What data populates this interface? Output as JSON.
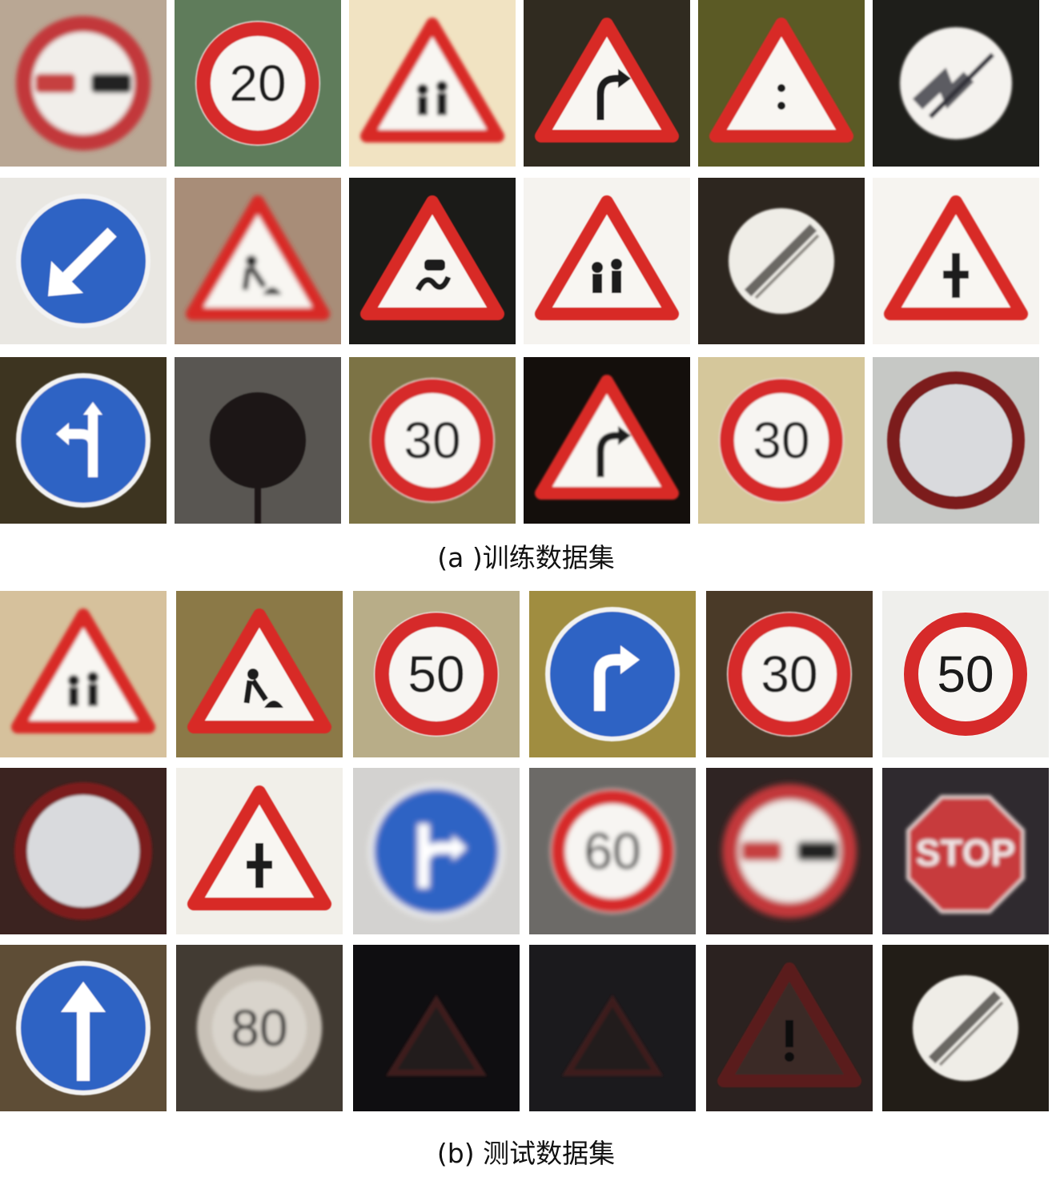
{
  "captions": {
    "train": "(a )训练数据集",
    "test": "(b) 测试数据集"
  },
  "train_tiles": [
    {
      "sign": "no-overtaking",
      "bg": "#b9a794",
      "blur": 3
    },
    {
      "sign": "speed-limit",
      "label": "20",
      "bg": "#5f7c5b",
      "blur": 0.8
    },
    {
      "sign": "warning-triangle",
      "glyph": "children",
      "bg": "#f1e3c2",
      "blur": 2
    },
    {
      "sign": "warning-triangle",
      "glyph": "curve-right",
      "bg": "#302b20",
      "blur": 0.5
    },
    {
      "sign": "warning-triangle",
      "glyph": "dot",
      "bg": "#5b5a25",
      "blur": 0.8
    },
    {
      "sign": "end-no-overtaking",
      "bg": "#1e1e1a",
      "blur": 1.5
    },
    {
      "sign": "blue-circle",
      "glyph": "arrow-down-left",
      "bg": "#e9e7e2",
      "blur": 0.6
    },
    {
      "sign": "warning-triangle",
      "glyph": "work",
      "bg": "#a88d78",
      "blur": 3
    },
    {
      "sign": "warning-triangle",
      "glyph": "slippery",
      "bg": "#1b1b18",
      "blur": 0.6
    },
    {
      "sign": "warning-triangle",
      "glyph": "children",
      "bg": "#f5f3ef",
      "blur": 0.4
    },
    {
      "sign": "end-restriction",
      "bg": "#2d261f",
      "blur": 1.2
    },
    {
      "sign": "warning-triangle",
      "glyph": "priority",
      "bg": "#f6f4f0",
      "blur": 0.8
    },
    {
      "sign": "blue-circle",
      "glyph": "straight-or-left",
      "bg": "#3d3420",
      "blur": 0.8
    },
    {
      "sign": "dark-circle",
      "bg": "#595652",
      "blur": 0.8
    },
    {
      "sign": "speed-limit",
      "label": "30",
      "bg": "#7c7345",
      "blur": 1
    },
    {
      "sign": "warning-triangle",
      "glyph": "curve-right",
      "bg": "#140f0c",
      "blur": 1.2
    },
    {
      "sign": "speed-limit",
      "label": "30",
      "bg": "#d5c79b",
      "blur": 1
    },
    {
      "sign": "no-entry-circle",
      "bg": "#c6c8c5",
      "blur": 0.8
    }
  ],
  "test_tiles": [
    {
      "sign": "warning-triangle",
      "glyph": "children",
      "bg": "#d6c19c",
      "blur": 2
    },
    {
      "sign": "warning-triangle",
      "glyph": "work",
      "bg": "#8b7947",
      "blur": 0.6
    },
    {
      "sign": "speed-limit",
      "label": "50",
      "bg": "#b8ad88",
      "blur": 0.5
    },
    {
      "sign": "blue-circle",
      "glyph": "turn-right",
      "bg": "#a08d40",
      "blur": 0.6
    },
    {
      "sign": "speed-limit",
      "label": "30",
      "bg": "#4a3a28",
      "blur": 0.8
    },
    {
      "sign": "speed-limit",
      "label": "50",
      "bg": "#efefec",
      "blur": 0
    },
    {
      "sign": "no-entry-circle",
      "bg": "#3b2320",
      "blur": 1.5
    },
    {
      "sign": "warning-triangle",
      "glyph": "priority",
      "bg": "#f1efe9",
      "blur": 0.6
    },
    {
      "sign": "blue-circle",
      "glyph": "straight-or-right",
      "bg": "#d3d2d0",
      "blur": 4
    },
    {
      "sign": "speed-limit",
      "label": "60",
      "bg": "#6c6a67",
      "blur": 3
    },
    {
      "sign": "no-overtaking",
      "bg": "#2f2423",
      "blur": 4
    },
    {
      "sign": "stop",
      "bg": "#2f2a2f",
      "blur": 2.5
    },
    {
      "sign": "blue-circle",
      "glyph": "arrow-up",
      "bg": "#5e4d36",
      "blur": 0.6
    },
    {
      "sign": "speed-limit-dim",
      "label": "80",
      "bg": "#423b33",
      "blur": 2
    },
    {
      "sign": "dark-triangle",
      "bg": "#0f0e11",
      "blur": 1.5
    },
    {
      "sign": "dark-triangle",
      "bg": "#1b1a1d",
      "blur": 1.5
    },
    {
      "sign": "warning-triangle-dim",
      "glyph": "exclamation",
      "bg": "#2b2220",
      "blur": 0.8
    },
    {
      "sign": "end-restriction",
      "bg": "#221d17",
      "blur": 1.2
    }
  ]
}
